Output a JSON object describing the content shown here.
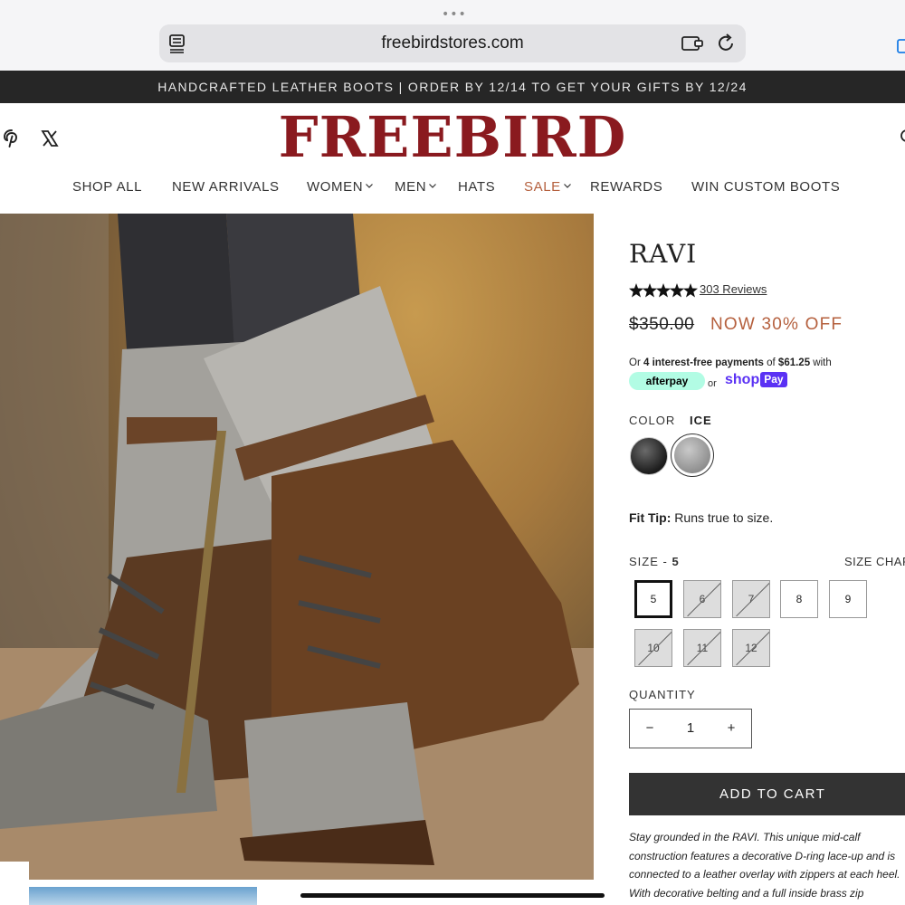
{
  "browser": {
    "url": "freebirdstores.com",
    "dots": "•••"
  },
  "promo": {
    "text": "HANDCRAFTED LEATHER BOOTS | ORDER BY 12/14 TO GET YOUR GIFTS BY 12/24"
  },
  "header": {
    "logo": "FREEBIRD",
    "nav": [
      {
        "label": "SHOP ALL"
      },
      {
        "label": "NEW ARRIVALS"
      },
      {
        "label": "WOMEN"
      },
      {
        "label": "MEN"
      },
      {
        "label": "HATS"
      },
      {
        "label": "SALE"
      },
      {
        "label": "REWARDS"
      },
      {
        "label": "WIN CUSTOM BOOTS"
      }
    ]
  },
  "product": {
    "title": "RAVI",
    "rating": 5,
    "reviews": "303 Reviews",
    "price_original": "$350.00",
    "price_sale": "NOW 30% OFF",
    "afterpay": {
      "prefix": "Or ",
      "bold1": "4 interest-free payments",
      "mid": " of ",
      "amount": "$61.25",
      "suffix": " with",
      "badge": "afterpay",
      "or": "or",
      "shop": "shop",
      "pay": "Pay"
    },
    "color_label": "COLOR",
    "color_value": "ICE",
    "fit_label": "Fit Tip:",
    "fit_text": "Runs true to size.",
    "size_label": "SIZE - ",
    "size_value": "5",
    "size_chart": "SIZE CHART",
    "sizes": [
      {
        "label": "5",
        "selected": true,
        "available": true
      },
      {
        "label": "6",
        "available": false
      },
      {
        "label": "7",
        "available": false
      },
      {
        "label": "8",
        "available": true
      },
      {
        "label": "9",
        "available": true
      },
      {
        "label": "10",
        "available": false
      },
      {
        "label": "11",
        "available": false
      },
      {
        "label": "12",
        "available": false
      }
    ],
    "quantity_label": "QUANTITY",
    "quantity": "1",
    "qty_minus": "−",
    "qty_plus": "+",
    "add_to_cart": "ADD TO CART",
    "description": "Stay grounded in the RAVI. This unique mid-calf construction features a decorative D-ring lace-up and is connected to a leather overlay with zippers at each heel. With decorative belting and a full inside brass zip"
  },
  "colors": {
    "brand": "#8a1a1f",
    "sale": "#b5603e",
    "afterpay": "#b2fce4",
    "shoppay": "#5a31f4"
  }
}
